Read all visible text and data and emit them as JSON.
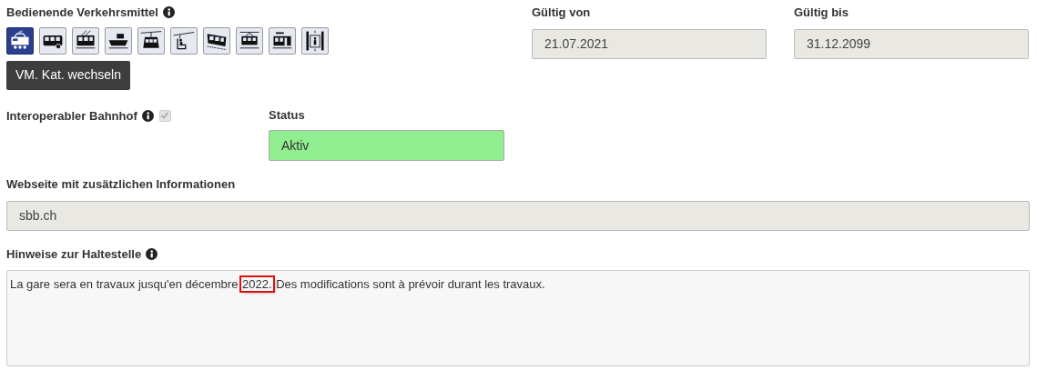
{
  "transport": {
    "label": "Bedienende Verkehrsmittel",
    "modes": [
      {
        "kind": "train",
        "selected": true
      },
      {
        "kind": "bus",
        "selected": false
      },
      {
        "kind": "tram",
        "selected": false
      },
      {
        "kind": "ship",
        "selected": false
      },
      {
        "kind": "gondola",
        "selected": false
      },
      {
        "kind": "chairlift",
        "selected": false
      },
      {
        "kind": "rack",
        "selected": false
      },
      {
        "kind": "funicular",
        "selected": false
      },
      {
        "kind": "metro",
        "selected": false
      },
      {
        "kind": "elevator",
        "selected": false
      }
    ],
    "button": "VM. Kat. wechseln"
  },
  "valid_from": {
    "label": "Gültig von",
    "value": "21.07.2021"
  },
  "valid_to": {
    "label": "Gültig bis",
    "value": "31.12.2099"
  },
  "interoperable": {
    "label": "Interoperabler Bahnhof",
    "checked": true,
    "disabled": true
  },
  "status": {
    "label": "Status",
    "value": "Aktiv",
    "color": "#90ee90"
  },
  "website": {
    "label": "Webseite mit zusätzlichen Informationen",
    "value": "sbb.ch"
  },
  "notes": {
    "label": "Hinweise zur Haltestelle",
    "segments": [
      {
        "text": "La gare sera en travaux jusqu'en décembre ",
        "highlighted": false
      },
      {
        "text": "2022.",
        "highlighted": true
      },
      {
        "text": " Des modifications sont à prévoir durant les travaux.",
        "highlighted": false
      }
    ]
  }
}
